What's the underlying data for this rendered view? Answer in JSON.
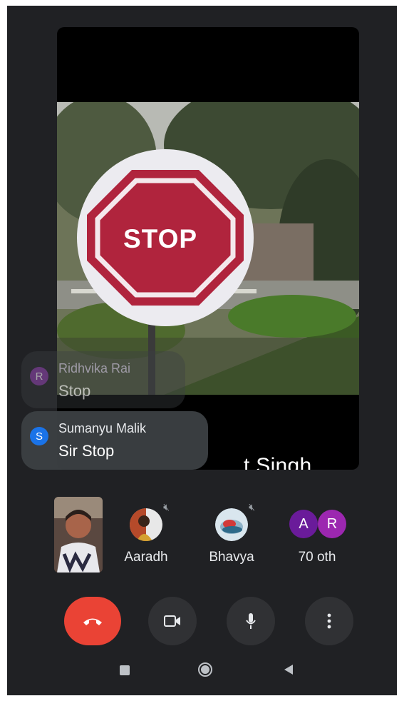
{
  "main_video": {
    "speaker_name_visible": "t Singh",
    "sign_text": "STOP"
  },
  "chat": [
    {
      "initial": "R",
      "name": "Ridhvika Rai",
      "message": "Stop",
      "avatar_color": "#8e44ad"
    },
    {
      "initial": "S",
      "name": "Sumanyu Malik",
      "message": "Sir Stop",
      "avatar_color": "#1a73e8"
    }
  ],
  "participants": [
    {
      "label": "Aaradh",
      "muted": true
    },
    {
      "label": "Bhavya",
      "muted": true
    },
    {
      "label": "70 oth",
      "group_initials": [
        "A",
        "R"
      ],
      "group_colors": [
        "#7b1fa2",
        "#8e24aa"
      ]
    }
  ],
  "controls": {
    "end_call_icon": "phone-hangup-icon",
    "camera_icon": "videocam-icon",
    "mic_icon": "mic-icon",
    "more_icon": "more-vert-icon"
  },
  "nav": [
    "recent-apps-icon",
    "home-icon",
    "back-icon"
  ]
}
